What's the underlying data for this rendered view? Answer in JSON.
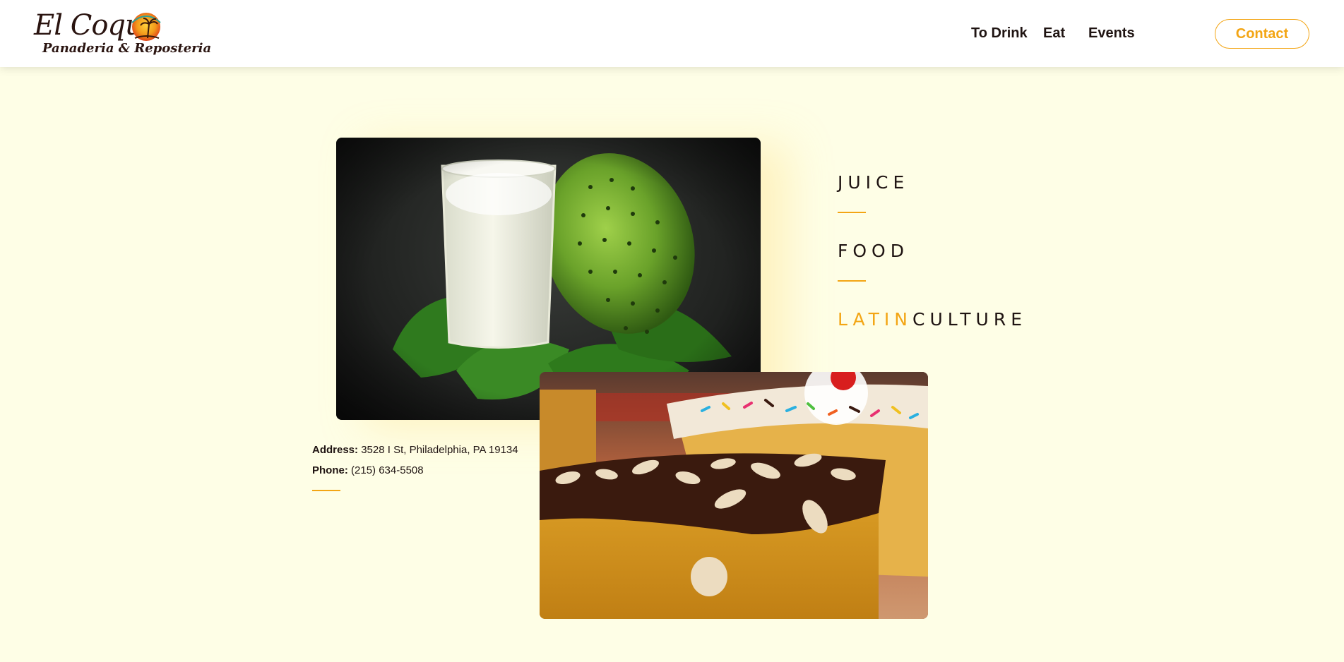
{
  "brand": {
    "name": "El Coqui",
    "tagline": "Panaderia & Reposteria"
  },
  "nav": {
    "items": [
      {
        "label": "To Drink"
      },
      {
        "label": "Eat"
      },
      {
        "label": "Events"
      }
    ],
    "contact_label": "Contact"
  },
  "categories": {
    "juice": "JUICE",
    "food": "FOOD",
    "latin_prefix": "LATIN",
    "latin_suffix": "CULTURE"
  },
  "contact_info": {
    "address_label": "Address:",
    "address_value": "3528 I St, Philadelphia, PA 19134",
    "phone_label": "Phone:",
    "phone_value": "(215) 634-5508"
  },
  "colors": {
    "accent": "#f3a514",
    "background": "#fefee6",
    "text": "#1f1412"
  },
  "images": {
    "hero_left": "soursop-juice-photo",
    "hero_right": "chocolate-almond-cake-photo"
  }
}
